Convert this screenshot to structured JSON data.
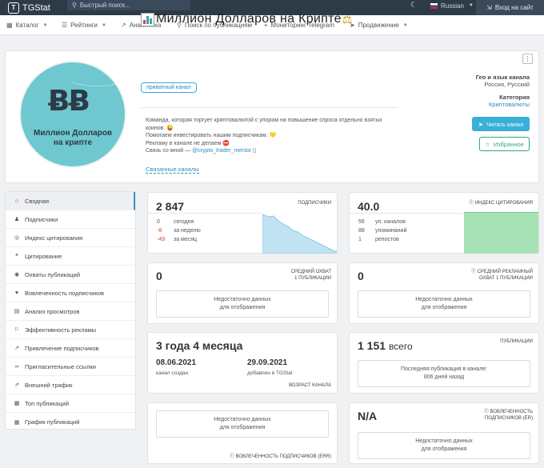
{
  "header": {
    "logo_text": "TGStat",
    "logo_mark": "T",
    "search_placeholder": "Быстрый поиск...",
    "language": "Russian",
    "login_label": "Вход на сайт"
  },
  "nav": [
    {
      "label": "Каталог",
      "icon": "catalog-icon",
      "dropdown": true
    },
    {
      "label": "Рейтинги",
      "icon": "ratings-icon",
      "dropdown": true
    },
    {
      "label": "Аналитика",
      "icon": "analytics-icon",
      "dropdown": false
    },
    {
      "label": "Поиск по публикациям",
      "icon": "search-icon",
      "dropdown": false
    },
    {
      "label": "Мониторинг Telegram",
      "icon": "monitoring-icon",
      "dropdown": false
    },
    {
      "label": "Продвижение",
      "icon": "promotion-icon",
      "dropdown": true
    }
  ],
  "channel": {
    "title": "Миллион Долларов на Крипте",
    "avatar_symbol": "ɃɃ",
    "avatar_line1": "Миллион Долларов",
    "avatar_line2": "на крипте",
    "badge": "приватный канал",
    "description": [
      "Команда, которая торгует криптовалютой с упором на повышение спроса отдельно взятых коинов. 😜",
      "Помогаем инвестировать нашим подписчикам. 💛",
      "Рекламу в канале не делаем ⛔",
      "Связь со мной —"
    ],
    "contact_link": "@crypto_trader_mentor",
    "related_link": "Связанные каналы",
    "geo_label": "Гео и язык канала",
    "geo_value": "Россия, Русский",
    "category_label": "Категория",
    "category_value": "Криптовалюты",
    "read_button": "Читать канал",
    "fav_button": "Избранное"
  },
  "sidebar": [
    {
      "label": "Сводная",
      "icon": "home-icon",
      "active": true
    },
    {
      "label": "Подписчики",
      "icon": "users-icon",
      "active": false
    },
    {
      "label": "Индекс цитирования",
      "icon": "citation-index-icon",
      "active": false
    },
    {
      "label": "Цитирование",
      "icon": "quote-icon",
      "active": false
    },
    {
      "label": "Охваты публикаций",
      "icon": "reach-icon",
      "active": false
    },
    {
      "label": "Вовлеченность подписчиков",
      "icon": "engagement-icon",
      "active": false
    },
    {
      "label": "Анализ просмотров",
      "icon": "views-icon",
      "active": false
    },
    {
      "label": "Эффективность рекламы",
      "icon": "ads-icon",
      "active": false
    },
    {
      "label": "Привлечение подписчиков",
      "icon": "growth-icon",
      "active": false
    },
    {
      "label": "Пригласительные ссылки",
      "icon": "link-icon",
      "active": false
    },
    {
      "label": "Внешний трафик",
      "icon": "external-icon",
      "active": false
    },
    {
      "label": "Топ публикаций",
      "icon": "top-icon",
      "active": false
    },
    {
      "label": "График публикаций",
      "icon": "calendar-icon",
      "active": false
    }
  ],
  "subscribers": {
    "value": "2 847",
    "label": "ПОДПИСЧИКИ",
    "today_value": "0",
    "today_label": "сегодня",
    "week_value": "-8",
    "week_label": "за неделю",
    "month_value": "-49",
    "month_label": "за месяц",
    "trend_color": "#bfe3f2"
  },
  "citation": {
    "value": "40.0",
    "label": "ИНДЕКС ЦИТИРОВАНИЯ",
    "channels_value": "56",
    "channels_label": "уп. каналов",
    "mentions_value": "88",
    "mentions_label": "упоминаний",
    "reposts_value": "1",
    "reposts_label": "репостов",
    "bar_color": "#9fdfb0"
  },
  "avg_reach": {
    "value": "0",
    "label1": "СРЕДНИЙ ОХВАТ",
    "label2": "1 ПУБЛИКАЦИИ",
    "nodata1": "Недостаточно данных",
    "nodata2": "для отображения"
  },
  "avg_ad_reach": {
    "value": "0",
    "label1": "СРЕДНИЙ РЕКЛАМНЫЙ",
    "label2": "ОХВАТ 1 ПУБЛИКАЦИИ",
    "nodata1": "Недостаточно данных",
    "nodata2": "для отображения"
  },
  "age": {
    "value": "3 года 4 месяца",
    "created_date": "08.06.2021",
    "created_label": "канал создан",
    "added_date": "29.09.2021",
    "added_label": "добавлен в TGStat",
    "label": "ВОЗРАСТ КАНАЛА"
  },
  "publications": {
    "value": "1 151",
    "suffix": "всего",
    "label": "ПУБЛИКАЦИИ",
    "last1": "Последняя публикация в канале:",
    "last2": "806 дней назад"
  },
  "err": {
    "nodata1": "Недостаточно данных",
    "nodata2": "для отображения",
    "label": "ВОВЛЕЧЕННОСТЬ ПОДПИСЧИКОВ (ERR)"
  },
  "er": {
    "value": "N/A",
    "label1": "ВОВЛЕЧЕННОСТЬ",
    "label2": "ПОДПИСЧИКОВ (ER)",
    "nodata1": "Недостаточно данных",
    "nodata2": "для отображения"
  }
}
